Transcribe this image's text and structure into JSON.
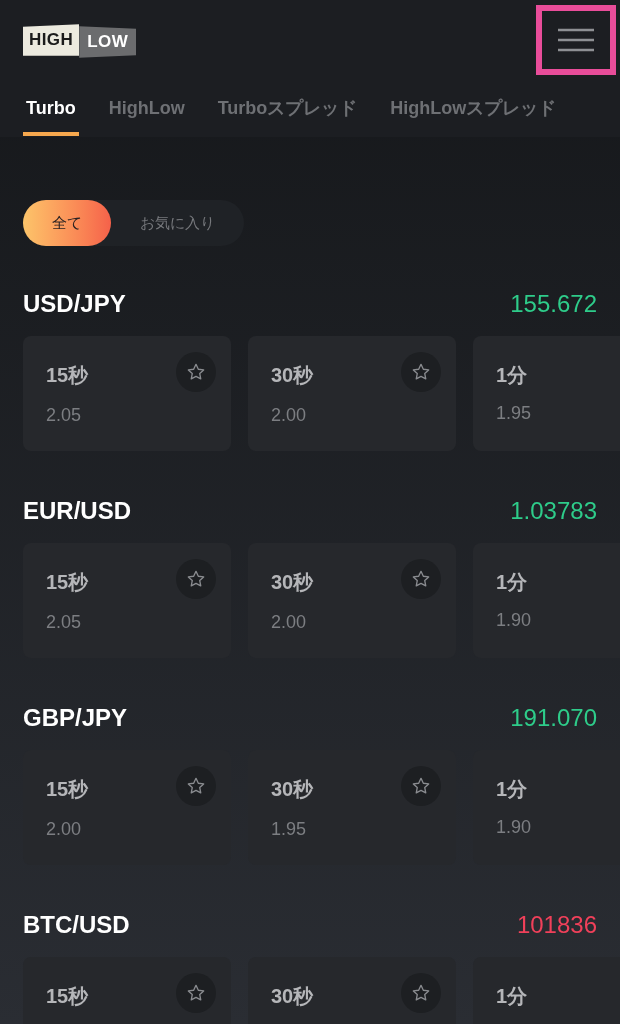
{
  "header": {
    "logo": {
      "left": "HIGH",
      "right": "LOW"
    },
    "menu_button": {
      "highlighted": true
    }
  },
  "tabs": [
    {
      "label": "Turbo",
      "selected": true
    },
    {
      "label": "HighLow",
      "selected": false
    },
    {
      "label": "Turboスプレッド",
      "selected": false
    },
    {
      "label": "HighLowスプレッド",
      "selected": false
    }
  ],
  "filter": [
    {
      "label": "全て",
      "selected": true
    },
    {
      "label": "お気に入り",
      "selected": false
    }
  ],
  "pairs": [
    {
      "name": "USD/JPY",
      "price": "155.672",
      "color": "#2ecc8a",
      "options": [
        {
          "duration": "15秒",
          "payout": "2.05"
        },
        {
          "duration": "30秒",
          "payout": "2.00"
        },
        {
          "duration": "1分",
          "payout": "1.95"
        }
      ]
    },
    {
      "name": "EUR/USD",
      "price": "1.03783",
      "color": "#2ecc8a",
      "options": [
        {
          "duration": "15秒",
          "payout": "2.05"
        },
        {
          "duration": "30秒",
          "payout": "2.00"
        },
        {
          "duration": "1分",
          "payout": "1.90"
        }
      ]
    },
    {
      "name": "GBP/JPY",
      "price": "191.070",
      "color": "#2ecc8a",
      "options": [
        {
          "duration": "15秒",
          "payout": "2.00"
        },
        {
          "duration": "30秒",
          "payout": "1.95"
        },
        {
          "duration": "1分",
          "payout": "1.90"
        }
      ]
    },
    {
      "name": "BTC/USD",
      "price": "101836",
      "color": "#f0405a",
      "options": [
        {
          "duration": "15秒"
        },
        {
          "duration": "30秒"
        },
        {
          "duration": "1分"
        }
      ]
    }
  ]
}
